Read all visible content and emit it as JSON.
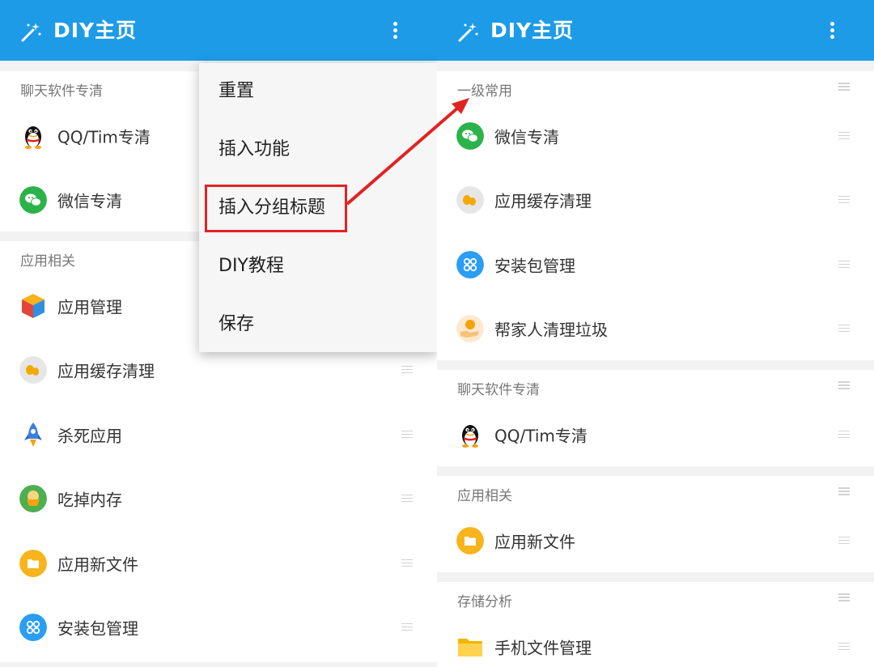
{
  "app": {
    "title": "DIY主页",
    "accent": "#1e9be6"
  },
  "left": {
    "sections": [
      {
        "title": "聊天软件专清",
        "items": [
          {
            "label": "QQ/Tim专清",
            "icon": "qq-penguin-icon"
          },
          {
            "label": "微信专清",
            "icon": "wechat-icon"
          }
        ]
      },
      {
        "title": "应用相关",
        "items": [
          {
            "label": "应用管理",
            "icon": "cube-icon"
          },
          {
            "label": "应用缓存清理",
            "icon": "cache-clean-icon"
          },
          {
            "label": "杀死应用",
            "icon": "rocket-icon"
          },
          {
            "label": "吃掉内存",
            "icon": "memory-eater-icon"
          },
          {
            "label": "应用新文件",
            "icon": "folder-icon"
          },
          {
            "label": "安装包管理",
            "icon": "package-grid-icon"
          }
        ]
      }
    ]
  },
  "menu": {
    "items": [
      "重置",
      "插入功能",
      "插入分组标题",
      "DIY教程",
      "保存"
    ],
    "highlighted": "插入分组标题",
    "highlight_color": "#e02323"
  },
  "right": {
    "sections": [
      {
        "title": "一级常用",
        "items": [
          {
            "label": "微信专清",
            "icon": "wechat-icon"
          },
          {
            "label": "应用缓存清理",
            "icon": "cache-clean-icon"
          },
          {
            "label": "安装包管理",
            "icon": "package-grid-icon"
          },
          {
            "label": "帮家人清理垃圾",
            "icon": "hand-coin-icon"
          }
        ]
      },
      {
        "title": "聊天软件专清",
        "items": [
          {
            "label": "QQ/Tim专清",
            "icon": "qq-penguin-icon"
          }
        ]
      },
      {
        "title": "应用相关",
        "items": [
          {
            "label": "应用新文件",
            "icon": "folder-icon"
          }
        ]
      },
      {
        "title": "存储分析",
        "items": [
          {
            "label": "手机文件管理",
            "icon": "file-folder-icon"
          }
        ]
      }
    ]
  }
}
